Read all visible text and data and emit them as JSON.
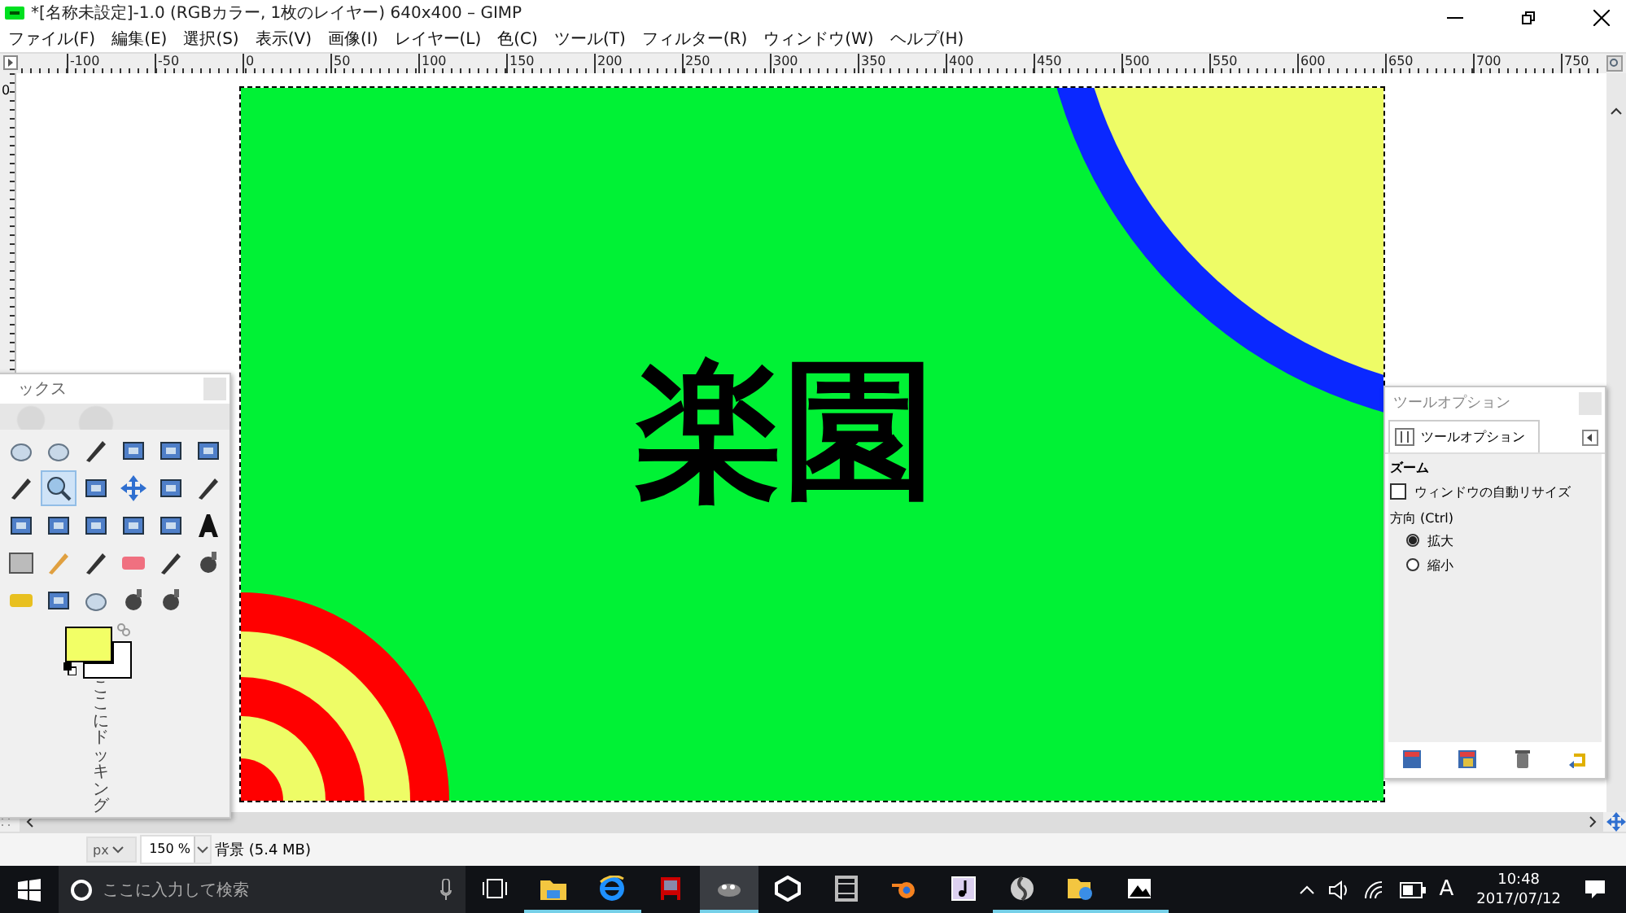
{
  "window": {
    "title": "*[名称未設定]-1.0 (RGBカラー, 1枚のレイヤー) 640x400 – GIMP"
  },
  "menu": [
    "ファイル(F)",
    "編集(E)",
    "選択(S)",
    "表示(V)",
    "画像(I)",
    "レイヤー(L)",
    "色(C)",
    "ツール(T)",
    "フィルター(R)",
    "ウィンドウ(W)",
    "ヘルプ(H)"
  ],
  "ruler": {
    "horizontal": [
      "-100",
      "-50",
      "0",
      "50",
      "100",
      "150",
      "200",
      "250",
      "300",
      "350",
      "400",
      "450",
      "500",
      "550",
      "600",
      "650",
      "700",
      "750"
    ],
    "vertical": [
      "0"
    ]
  },
  "image": {
    "text": "楽園"
  },
  "toolbox": {
    "title": "ックス",
    "tools": [
      {
        "selected": false
      },
      {
        "selected": false
      },
      {
        "selected": false
      },
      {
        "selected": false
      },
      {
        "selected": false
      },
      {
        "selected": false
      },
      {
        "selected": false
      },
      {
        "selected": true
      },
      {
        "selected": false
      },
      {
        "selected": false
      },
      {
        "selected": false
      },
      {
        "selected": false
      },
      {
        "selected": false
      },
      {
        "selected": false
      },
      {
        "selected": false
      },
      {
        "selected": false
      },
      {
        "selected": false
      },
      {
        "selected": false
      },
      {
        "selected": false
      },
      {
        "selected": false
      },
      {
        "selected": false
      },
      {
        "selected": false
      },
      {
        "selected": false
      },
      {
        "selected": false
      },
      {
        "selected": false
      },
      {
        "selected": false
      },
      {
        "selected": false
      },
      {
        "selected": false
      },
      {
        "selected": false
      }
    ],
    "foreground": {
      "color": "#f2ff66"
    },
    "background": {
      "color": "#ffffff"
    },
    "dock_hint": "ここにドッキング"
  },
  "tool_options": {
    "title": "ツールオプション",
    "tab": {
      "label": "ツールオプション",
      "selected": true
    },
    "section": "ズーム",
    "checkbox": {
      "label": "ウィンドウの自動リサイズ",
      "checked": false
    },
    "group_label": "方向 (Ctrl)",
    "radios": [
      {
        "label": "拡大",
        "selected": true
      },
      {
        "label": "縮小",
        "selected": false
      }
    ]
  },
  "status_bar": {
    "unit": "px",
    "zoom": "150 %",
    "layer_info": "背景 (5.4 MB)"
  },
  "taskbar": {
    "search_placeholder": "ここに入力して検索",
    "apps": [
      {
        "running": true,
        "active": false
      },
      {
        "running": true,
        "active": false
      },
      {
        "running": false,
        "active": false
      },
      {
        "running": true,
        "active": true
      },
      {
        "running": false,
        "active": false
      },
      {
        "running": false,
        "active": false
      },
      {
        "running": false,
        "active": false
      },
      {
        "running": false,
        "active": false
      },
      {
        "running": true,
        "active": false
      },
      {
        "running": true,
        "active": false
      },
      {
        "running": true,
        "active": false
      }
    ],
    "tray": {
      "ime": "A",
      "time": "10:48",
      "date": "2017/07/12"
    }
  }
}
